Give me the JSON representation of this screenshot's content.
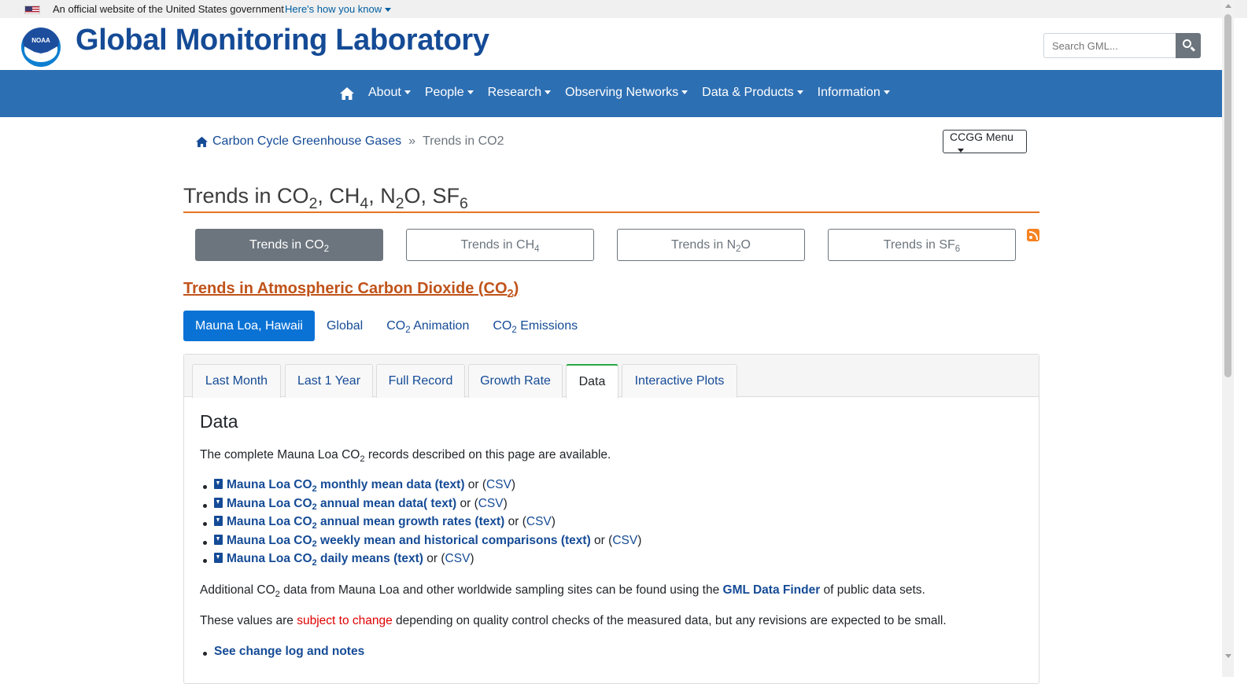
{
  "gov_banner": {
    "text": "An official website of the United States government",
    "link": "Here's how you know"
  },
  "header": {
    "logo_text": "NOAA",
    "site_title": "Global Monitoring Laboratory",
    "search_placeholder": "Search GML..."
  },
  "nav": {
    "items": [
      "About",
      "People",
      "Research",
      "Observing Networks",
      "Data & Products",
      "Information"
    ]
  },
  "breadcrumb": {
    "home": "Carbon Cycle Greenhouse Gases",
    "separator": "»",
    "current": "Trends in CO2"
  },
  "ccgg_menu": "CCGG Menu",
  "page_heading": {
    "co": "Trends in CO",
    "co_sub": "2",
    "ch": ", CH",
    "ch_sub": "4",
    "n": ", N",
    "n_sub": "2",
    "o_sf": "O, SF",
    "sf_sub": "6"
  },
  "gas_buttons": [
    {
      "prefix": "Trends in CO",
      "sub": "2",
      "suffix": ""
    },
    {
      "prefix": "Trends in CH",
      "sub": "4",
      "suffix": ""
    },
    {
      "prefix": "Trends in N",
      "sub": "2",
      "suffix": "O"
    },
    {
      "prefix": "Trends in SF",
      "sub": "6",
      "suffix": ""
    }
  ],
  "section_title": {
    "prefix": "Trends in Atmospheric Carbon Dioxide (CO",
    "sub": "2",
    "suffix": ")"
  },
  "pills": [
    {
      "prefix": "Mauna Loa, Hawaii",
      "sub": "",
      "suffix": ""
    },
    {
      "prefix": "Global",
      "sub": "",
      "suffix": ""
    },
    {
      "prefix": "CO",
      "sub": "2",
      "suffix": " Animation"
    },
    {
      "prefix": "CO",
      "sub": "2",
      "suffix": " Emissions"
    }
  ],
  "tabs": [
    "Last Month",
    "Last 1 Year",
    "Full Record",
    "Growth Rate",
    "Data",
    "Interactive Plots"
  ],
  "data_section": {
    "title": "Data",
    "intro_prefix": "The complete Mauna Loa CO",
    "intro_sub": "2",
    "intro_suffix": " records described on this page are available.",
    "downloads": [
      {
        "prefix": "Mauna Loa CO",
        "sub": "2",
        "suffix": " monthly mean data (text)",
        "or": " or (",
        "csv": "CSV",
        "close": ")"
      },
      {
        "prefix": "Mauna Loa CO",
        "sub": "2",
        "suffix": " annual mean data( text)",
        "or": " or (",
        "csv": "CSV",
        "close": ")"
      },
      {
        "prefix": "Mauna Loa CO",
        "sub": "2",
        "suffix": " annual mean growth rates (text)",
        "or": " or (",
        "csv": "CSV",
        "close": ")"
      },
      {
        "prefix": "Mauna Loa CO",
        "sub": "2",
        "suffix": " weekly mean and historical comparisons (text)",
        "or": " or (",
        "csv": "CSV",
        "close": ")"
      },
      {
        "prefix": "Mauna Loa CO",
        "sub": "2",
        "suffix": " daily means (text)",
        "or": " or (",
        "csv": "CSV",
        "close": ")"
      }
    ],
    "additional_prefix": "Additional CO",
    "additional_sub": "2",
    "additional_mid": " data from Mauna Loa and other worldwide sampling sites can be found using the ",
    "additional_link": "GML Data Finder",
    "additional_suffix": " of public data sets.",
    "values_prefix": "These values are ",
    "values_link": "subject to change",
    "values_suffix": " depending on quality control checks of the measured data, but any revisions are expected to be small.",
    "changelog": "See change log and notes"
  },
  "colors": {
    "nav_bg": "#2d6fb3",
    "title_blue": "#154b96",
    "accent_orange": "#e8731f",
    "section_title": "#c0531a",
    "pill_active": "#0a72d5",
    "tab_active_border": "#28a745"
  }
}
